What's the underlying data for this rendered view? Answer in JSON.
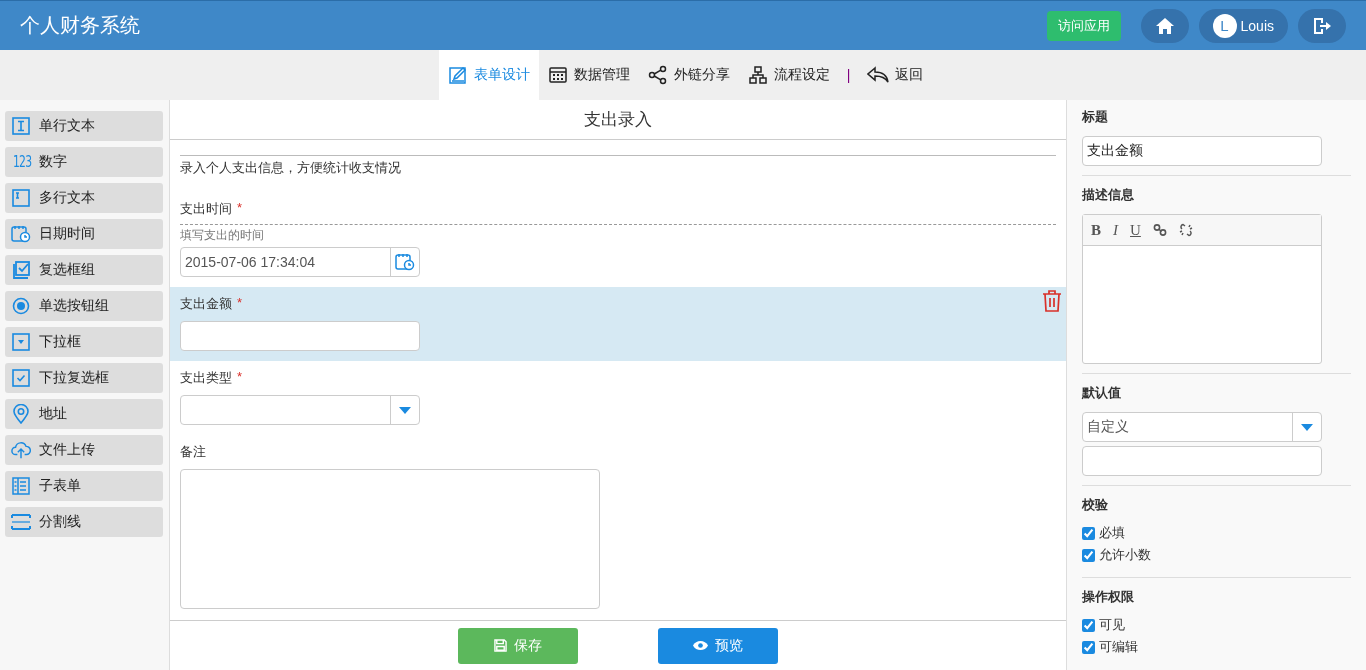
{
  "header": {
    "title": "个人财务系统",
    "visit_button": "访问应用",
    "user": {
      "initial": "L",
      "name": "Louis"
    }
  },
  "toolbar": {
    "tabs": [
      {
        "label": "表单设计",
        "kind": "design",
        "selected": true
      },
      {
        "label": "数据管理",
        "kind": "data",
        "selected": false
      },
      {
        "label": "外链分享",
        "kind": "share",
        "selected": false
      },
      {
        "label": "流程设定",
        "kind": "flow",
        "selected": false
      }
    ],
    "separator": "|",
    "back": "返回"
  },
  "palette": [
    {
      "label": "单行文本",
      "kind": "text"
    },
    {
      "label": "数字",
      "kind": "number",
      "glyph": "123"
    },
    {
      "label": "多行文本",
      "kind": "textarea"
    },
    {
      "label": "日期时间",
      "kind": "datetime"
    },
    {
      "label": "复选框组",
      "kind": "checkbox"
    },
    {
      "label": "单选按钮组",
      "kind": "radio"
    },
    {
      "label": "下拉框",
      "kind": "select"
    },
    {
      "label": "下拉复选框",
      "kind": "multiselect"
    },
    {
      "label": "地址",
      "kind": "address"
    },
    {
      "label": "文件上传",
      "kind": "upload"
    },
    {
      "label": "子表单",
      "kind": "subform"
    },
    {
      "label": "分割线",
      "kind": "divider"
    }
  ],
  "form": {
    "title": "支出录入",
    "description": "录入个人支出信息，方便统计收支情况",
    "fields": [
      {
        "kind": "datetime",
        "label": "支出时间",
        "required_mark": "*",
        "hint": "填写支出的时间",
        "value": "2015-07-06 17:34:04",
        "selected": false
      },
      {
        "kind": "text",
        "label": "支出金额",
        "required_mark": "*",
        "selected": true
      },
      {
        "kind": "select",
        "label": "支出类型",
        "required_mark": "*",
        "selected": false
      },
      {
        "kind": "textarea",
        "label": "备注",
        "selected": false
      }
    ],
    "buttons": [
      {
        "kind": "save",
        "label": "保存"
      },
      {
        "kind": "preview",
        "label": "预览"
      }
    ]
  },
  "properties": {
    "title": {
      "label": "标题",
      "value": "支出金额"
    },
    "description": {
      "label": "描述信息",
      "tools": [
        "B",
        "I",
        "U"
      ]
    },
    "default": {
      "label": "默认值",
      "select": "自定义"
    },
    "validation": {
      "label": "校验",
      "options": [
        {
          "label": "必填",
          "checked": true
        },
        {
          "label": "允许小数",
          "checked": true
        }
      ]
    },
    "permissions": {
      "label": "操作权限",
      "options": [
        {
          "label": "可见",
          "checked": true
        },
        {
          "label": "可编辑",
          "checked": true
        }
      ]
    }
  }
}
